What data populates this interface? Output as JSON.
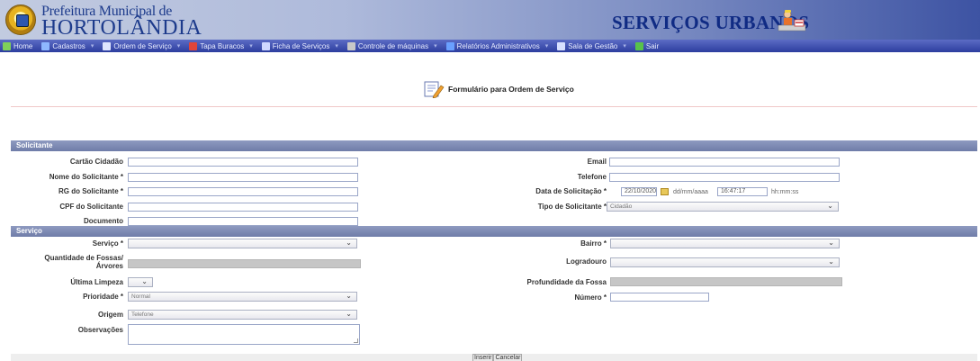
{
  "header": {
    "brand_line1": "Prefeitura Municipal de",
    "brand_line2": "HORTOLÂNDIA",
    "section_title": "SERVIÇOS URBANOS"
  },
  "menu": [
    {
      "label": "Home",
      "icon": "home-icon",
      "color": "#7fcf5a"
    },
    {
      "label": "Cadastros",
      "icon": "folder-icon",
      "color": "#8fb8ff"
    },
    {
      "label": "Ordem de Serviço",
      "icon": "document-icon",
      "color": "#dfe6ff"
    },
    {
      "label": "Tapa Buracos",
      "icon": "road-icon",
      "color": "#e0453a"
    },
    {
      "label": "Ficha de Serviços",
      "icon": "form-icon",
      "color": "#cfd8ff"
    },
    {
      "label": "Controle de máquinas",
      "icon": "gear-icon",
      "color": "#c8c8c8"
    },
    {
      "label": "Relatórios Administrativos",
      "icon": "report-icon",
      "color": "#6aa0ff"
    },
    {
      "label": "Sala de Gestão",
      "icon": "chart-icon",
      "color": "#d8e0ff"
    },
    {
      "label": "Sair",
      "icon": "exit-icon",
      "color": "#58c24a"
    }
  ],
  "page_title": "Formulário para Ordem de Serviço",
  "solicitante": {
    "section_label": "Solicitante",
    "cartao_label": "Cartão Cidadão",
    "nome_label": "Nome do Solicitante *",
    "rg_label": "RG do Solicitante *",
    "cpf_label": "CPF do Solicitante",
    "documento_label": "Documento",
    "email_label": "Email",
    "telefone_label": "Telefone",
    "data_label": "Data de Solicitação *",
    "data_value": "22/10/2020",
    "data_hint": "dd/mm/aaaa",
    "hora_value": "16:47:17",
    "hora_hint": "hh:mm:ss",
    "tipo_label": "Tipo de Solicitante *",
    "tipo_value": "Cidadão"
  },
  "servico": {
    "section_label": "Serviço",
    "servico_label": "Serviço *",
    "quantidade_label_1": "Quantidade de Fossas/",
    "quantidade_label_2": "Árvores",
    "ultima_label": "Última Limpeza",
    "prioridade_label": "Prioridade *",
    "prioridade_value": "Normal",
    "origem_label": "Origem",
    "origem_value": "Telefone",
    "observacoes_label": "Observações",
    "bairro_label": "Bairro *",
    "logradouro_label": "Logradouro",
    "profundidade_label": "Profundidade da Fossa",
    "numero_label": "Número *"
  },
  "buttons": {
    "inserir": "Inserir",
    "cancelar": "Cancelar"
  }
}
